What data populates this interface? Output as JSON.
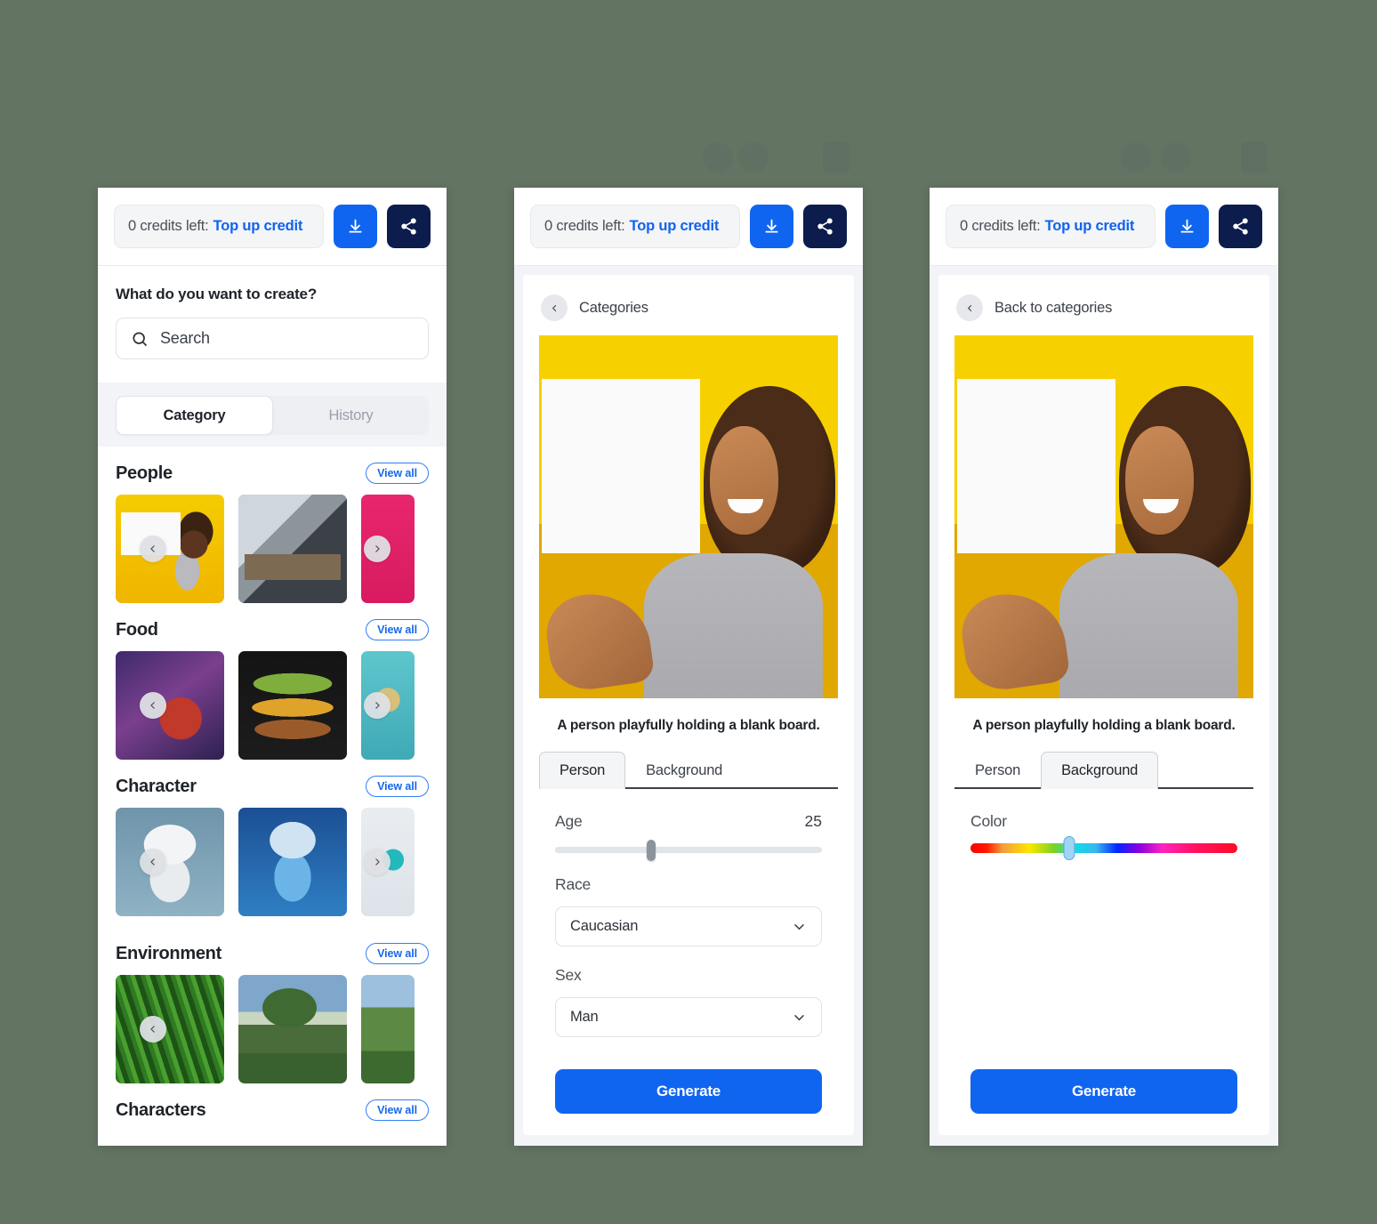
{
  "background_color": "#647463",
  "accent_blue": "#1065f0",
  "navy": "#0c1c4c",
  "topbar": {
    "credits_text": "0 credits left:",
    "topup_label": "Top up credit",
    "download_icon": "download-icon",
    "share_icon": "share-icon"
  },
  "panel1": {
    "create_question": "What do you want to create?",
    "search_placeholder": "Search",
    "search_icon": "search-icon",
    "tabs": [
      {
        "label": "Category",
        "active": true
      },
      {
        "label": "History",
        "active": false
      }
    ],
    "view_all_label": "View all",
    "categories": [
      {
        "title": "People",
        "view_all": "View all",
        "thumbs": [
          "art-people1",
          "art-people2",
          "art-people3"
        ]
      },
      {
        "title": "Food",
        "view_all": "View all",
        "thumbs": [
          "art-food1",
          "art-food2",
          "art-food3"
        ]
      },
      {
        "title": "Character",
        "view_all": "View all",
        "thumbs": [
          "art-char1",
          "art-char2",
          "art-char3"
        ]
      },
      {
        "title": "Environment",
        "view_all": "View all",
        "thumbs": [
          "art-env1",
          "art-env2",
          "art-env3"
        ]
      },
      {
        "title": "Characters",
        "view_all": "View all",
        "thumbs": []
      }
    ]
  },
  "panel2": {
    "breadcrumb_label": "Categories",
    "back_icon": "chevron-left-icon",
    "caption": "A person playfully holding a blank board.",
    "tabs": [
      {
        "label": "Person",
        "active": true
      },
      {
        "label": "Background",
        "active": false
      }
    ],
    "age": {
      "label": "Age",
      "value": "25",
      "percent": 36
    },
    "race": {
      "label": "Race",
      "value": "Caucasian"
    },
    "sex": {
      "label": "Sex",
      "value": "Man"
    },
    "generate_label": "Generate"
  },
  "panel3": {
    "breadcrumb_label": "Back to categories",
    "back_icon": "chevron-left-icon",
    "caption": "A person playfully holding a blank board.",
    "tabs": [
      {
        "label": "Person",
        "active": false
      },
      {
        "label": "Background",
        "active": true
      }
    ],
    "color": {
      "label": "Color",
      "percent": 37
    },
    "generate_label": "Generate"
  }
}
